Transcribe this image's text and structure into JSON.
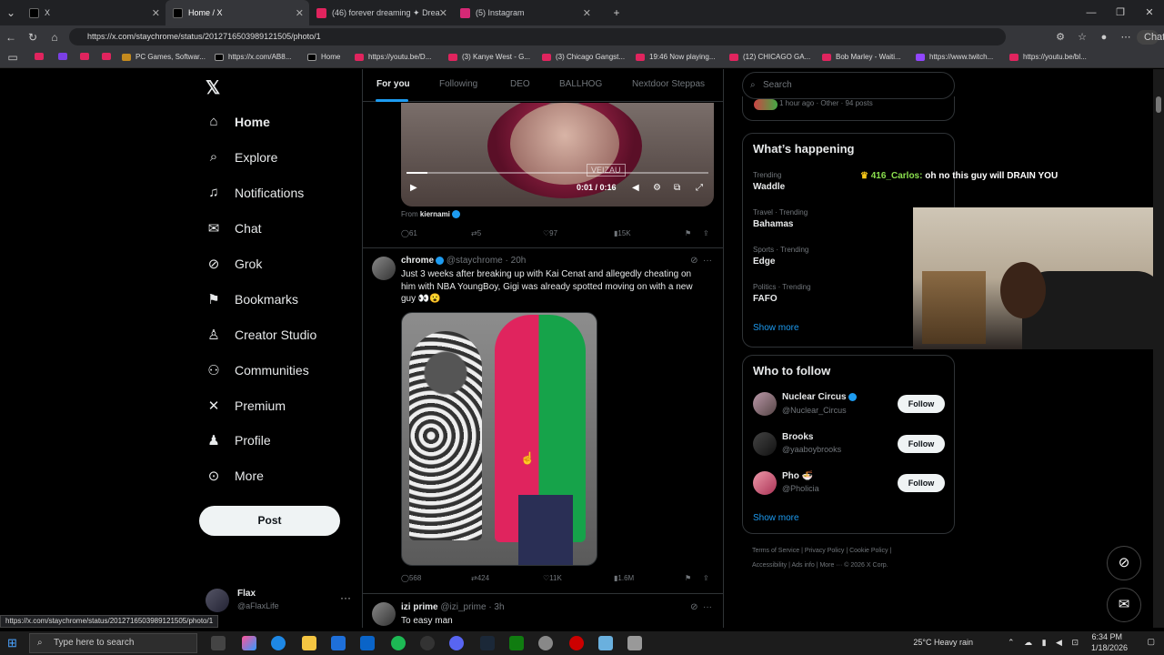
{
  "browser": {
    "tabs": [
      {
        "label": "X",
        "color": "#000000"
      },
      {
        "label": "Home / X",
        "color": "#000000"
      },
      {
        "label": "(46) forever dreaming ✦ Drea",
        "color": "#e0245e"
      },
      {
        "label": "(5) Instagram",
        "color": "#d62976"
      }
    ],
    "url": "https://x.com/staychrome/status/2012716503989121505/photo/1",
    "chat_label": "Chat",
    "bookmarks": [
      "PC Games, Softwar...",
      "https://x.com/AB8...",
      "Home",
      "https://youtu.be/D...",
      "(3) Kanye West - G...",
      "(3) Chicago Gangst...",
      "19:46 Now playing...",
      "(12) CHICAGO GA...",
      "Bob Marley - Waiti...",
      "https://www.twitch...",
      "https://youtu.be/bl..."
    ]
  },
  "sidebar": {
    "items": [
      {
        "label": "Home",
        "icon": "home-icon"
      },
      {
        "label": "Explore",
        "icon": "search-icon"
      },
      {
        "label": "Notifications",
        "icon": "bell-icon"
      },
      {
        "label": "Chat",
        "icon": "mail-icon"
      },
      {
        "label": "Grok",
        "icon": "grok-icon"
      },
      {
        "label": "Bookmarks",
        "icon": "bookmark-icon"
      },
      {
        "label": "Creator Studio",
        "icon": "creator-icon"
      },
      {
        "label": "Communities",
        "icon": "communities-icon"
      },
      {
        "label": "Premium",
        "icon": "x-icon"
      },
      {
        "label": "Profile",
        "icon": "person-icon"
      },
      {
        "label": "More",
        "icon": "more-icon"
      }
    ],
    "post_label": "Post",
    "profile": {
      "name": "Flax",
      "handle": "@aFlaxLife"
    }
  },
  "feed": {
    "tabs": [
      "For you",
      "Following",
      "DEO",
      "BALLHOG",
      "Nextdoor Steppas"
    ],
    "video": {
      "time": "0:01 / 0:16",
      "watermark": "VEIZAU",
      "from_label": "From",
      "from_user": "kiernami"
    },
    "video_actions": {
      "replies": "61",
      "reposts": "5",
      "likes": "97",
      "views": "15K"
    },
    "tweet1": {
      "name": "chrome",
      "handle": "@staychrome",
      "time": "· 20h",
      "text": "Just 3 weeks after breaking up with Kai Cenat and allegedly cheating on him with NBA YoungBoy, Gigi was already spotted moving on with a new guy 👀😮",
      "actions": {
        "replies": "568",
        "reposts": "424",
        "likes": "11K",
        "views": "1.6M"
      }
    },
    "tweet2": {
      "name": "izi prime",
      "handle": "@izi_prime",
      "time": "· 3h",
      "text": "To easy man"
    }
  },
  "right": {
    "search_placeholder": "Search",
    "live_text": "1 hour ago · Other · 94 posts",
    "whats_happening": "What’s happening",
    "trends": [
      {
        "category": "Trending",
        "name": "Waddle"
      },
      {
        "category": "Travel · Trending",
        "name": "Bahamas"
      },
      {
        "category": "Sports · Trending",
        "name": "Edge"
      },
      {
        "category": "Politics · Trending",
        "name": "FAFO"
      }
    ],
    "show_more": "Show more",
    "who_to_follow": "Who to follow",
    "follow_label": "Follow",
    "suggestions": [
      {
        "name": "Nuclear Circus",
        "handle": "@Nuclear_Circus"
      },
      {
        "name": "Brooks",
        "handle": "@yaaboybrooks"
      },
      {
        "name": "Pho 🍜",
        "handle": "@Pholicia"
      }
    ],
    "footer1": "Terms of Service  |  Privacy Policy  |  Cookie Policy  |",
    "footer2": "Accessibility  |  Ads info  |  More ···  © 2026 X Corp."
  },
  "overlay": {
    "chat_user": "416_Carlos:",
    "chat_msg": "oh no this guy will DRAIN YOU"
  },
  "status_url": "https://x.com/staychrome/status/2012716503989121505/photo/1",
  "taskbar": {
    "search_placeholder": "Type here to search",
    "weather": "25°C  Heavy rain",
    "time": "6:34 PM",
    "date": "1/18/2026"
  }
}
